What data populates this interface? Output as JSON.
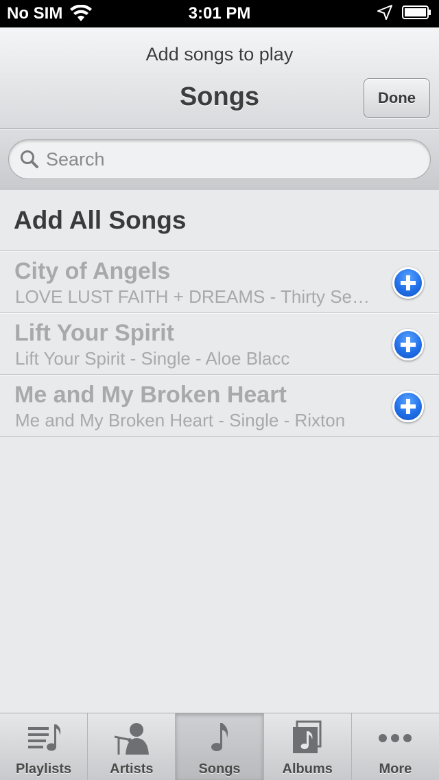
{
  "status_bar": {
    "carrier": "No SIM",
    "time": "3:01 PM"
  },
  "nav": {
    "prompt": "Add songs to play",
    "title": "Songs",
    "done_label": "Done"
  },
  "search": {
    "placeholder": "Search"
  },
  "add_all_label": "Add All Songs",
  "songs": [
    {
      "title": "City of Angels",
      "subtitle": "LOVE LUST FAITH + DREAMS - Thirty Seconds To Mars"
    },
    {
      "title": "Lift Your Spirit",
      "subtitle": "Lift Your Spirit - Single - Aloe Blacc"
    },
    {
      "title": "Me and My Broken Heart",
      "subtitle": "Me and My Broken Heart - Single - Rixton"
    }
  ],
  "tabs": [
    {
      "label": "Playlists",
      "icon": "playlists-icon"
    },
    {
      "label": "Artists",
      "icon": "artists-icon"
    },
    {
      "label": "Songs",
      "icon": "songs-icon",
      "active": true
    },
    {
      "label": "Albums",
      "icon": "albums-icon"
    },
    {
      "label": "More",
      "icon": "more-icon"
    }
  ],
  "colors": {
    "accent": "#2170e8",
    "dimmed_text": "#a8a9ab"
  }
}
